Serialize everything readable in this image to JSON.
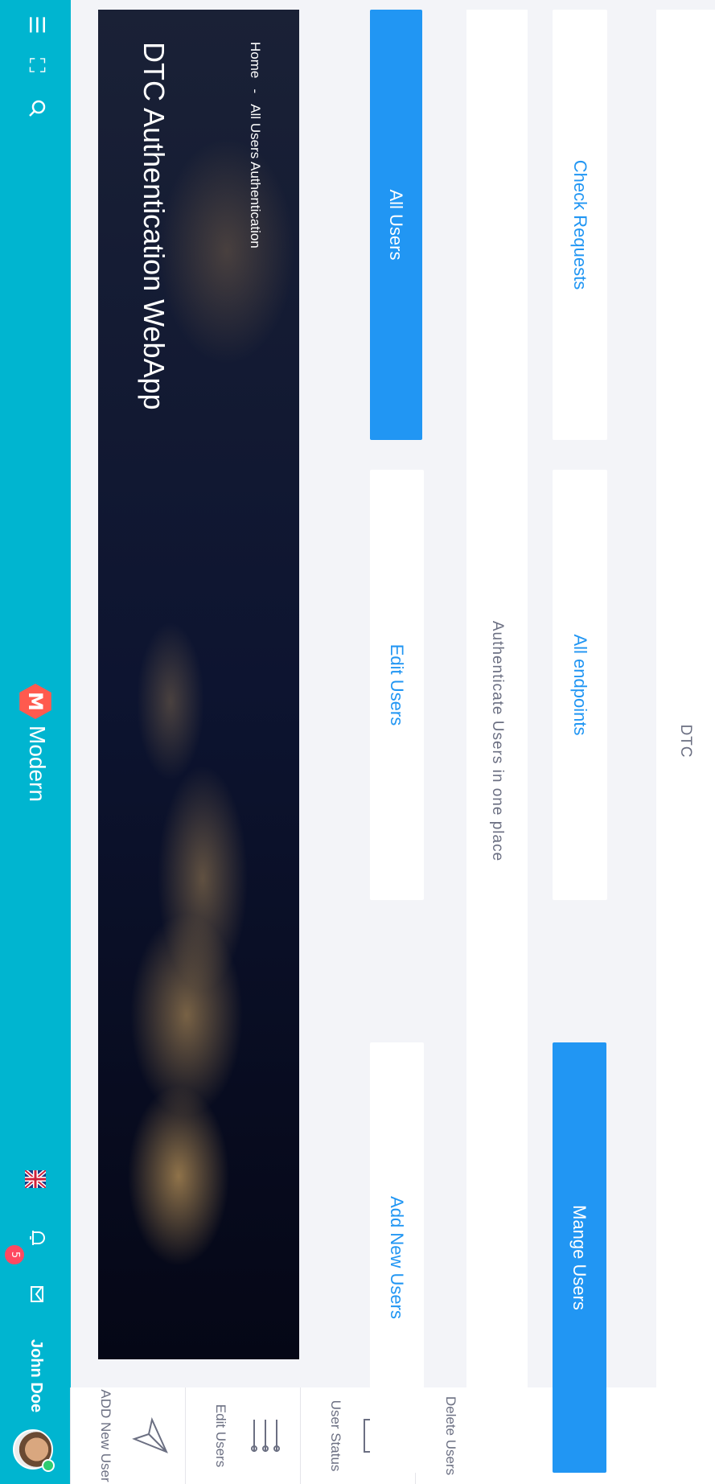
{
  "navbar": {
    "brand_letter": "M",
    "brand_name": "Modern",
    "notification_count": "5",
    "username": "John Doe",
    "icons": [
      "menu-icon",
      "fullscreen-icon",
      "search-icon",
      "flag-uk-icon",
      "bell-icon",
      "mail-icon"
    ]
  },
  "sidebar": {
    "items": [
      {
        "label": "ADD New User",
        "icon": "send-icon",
        "glyph": "➤"
      },
      {
        "label": "Edit Users",
        "icon": "sliders-icon",
        "glyph": "⫶"
      },
      {
        "label": "User Status",
        "icon": "server-icon",
        "glyph": "▤"
      },
      {
        "label": "Delete Users",
        "icon": "book-icon",
        "glyph": "▣"
      }
    ]
  },
  "hero": {
    "title": "DTC Authentication WebApp",
    "breadcrumb": {
      "home": "Home",
      "separator": "-",
      "current": "All Users Authentication"
    }
  },
  "actions": {
    "row1": [
      "All Users",
      "Edit Users",
      "Add New Users"
    ],
    "tagline": "Authenticate Users in one place",
    "row2": [
      "Check Requests",
      "All endpoints",
      "Mange Users"
    ],
    "footer_label": "DTC"
  },
  "colors": {
    "navbar": "#00b5d0",
    "accent": "#2196f3",
    "badge": "#ff4961"
  }
}
